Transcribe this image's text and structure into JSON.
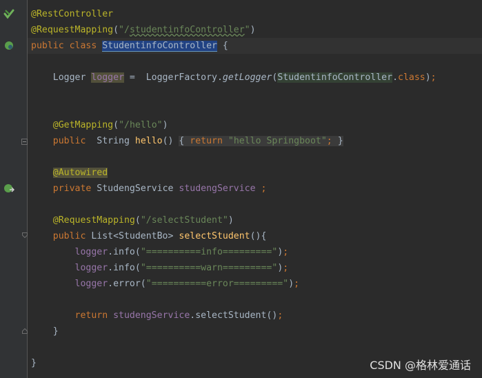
{
  "editor": {
    "lines": [
      [
        {
          "t": "@RestController",
          "c": "ann"
        }
      ],
      [
        {
          "t": "@RequestMapping",
          "c": "ann"
        },
        {
          "t": "("
        },
        {
          "t": "\"/",
          "c": "str"
        },
        {
          "t": "studentinfoController",
          "c": "str squig"
        },
        {
          "t": "\"",
          "c": "str"
        },
        {
          "t": ")"
        }
      ],
      [
        {
          "t": "public class ",
          "c": "kw"
        },
        {
          "t": "StudentinfoController",
          "c": "sel"
        },
        {
          "t": " {"
        }
      ],
      [],
      [
        {
          "t": "    Logger "
        },
        {
          "t": "logger",
          "c": "fld hl-var"
        },
        {
          "t": " =  LoggerFactory."
        },
        {
          "t": "getLogger",
          "c": "italic"
        },
        {
          "t": "("
        },
        {
          "t": "StudentinfoController",
          "c": "hl-ref"
        },
        {
          "t": "."
        },
        {
          "t": "class",
          "c": "kw"
        },
        {
          "t": ")"
        },
        {
          "t": ";",
          "c": "kw"
        }
      ],
      [],
      [],
      [
        {
          "t": "    "
        },
        {
          "t": "@GetMapping",
          "c": "ann"
        },
        {
          "t": "("
        },
        {
          "t": "\"/hello\"",
          "c": "str"
        },
        {
          "t": ")"
        }
      ],
      [
        {
          "t": "    "
        },
        {
          "t": "public  ",
          "c": "kw"
        },
        {
          "t": "String "
        },
        {
          "t": "hello",
          "c": "meth"
        },
        {
          "t": "() "
        },
        {
          "t": "{ ",
          "c": "fold-txt"
        },
        {
          "t": "return ",
          "c": "kw fold-txt"
        },
        {
          "t": "\"hello Springboot\"",
          "c": "str fold-txt"
        },
        {
          "t": ";",
          "c": "kw fold-txt"
        },
        {
          "t": " }",
          "c": "fold-txt"
        }
      ],
      [],
      [
        {
          "t": "    "
        },
        {
          "t": "@Autowired",
          "c": "ann hl-var"
        }
      ],
      [
        {
          "t": "    "
        },
        {
          "t": "private ",
          "c": "kw"
        },
        {
          "t": "StudengService "
        },
        {
          "t": "studengService",
          "c": "fld"
        },
        {
          "t": " ;",
          "c": "kw"
        }
      ],
      [],
      [
        {
          "t": "    "
        },
        {
          "t": "@RequestMapping",
          "c": "ann"
        },
        {
          "t": "("
        },
        {
          "t": "\"/selectStudent\"",
          "c": "str"
        },
        {
          "t": ")"
        }
      ],
      [
        {
          "t": "    "
        },
        {
          "t": "public ",
          "c": "kw"
        },
        {
          "t": "List<StudentBo> "
        },
        {
          "t": "selectStudent",
          "c": "meth"
        },
        {
          "t": "(){"
        }
      ],
      [
        {
          "t": "        "
        },
        {
          "t": "logger",
          "c": "fld"
        },
        {
          "t": ".info("
        },
        {
          "t": "\"==========info=========\"",
          "c": "str"
        },
        {
          "t": ")"
        },
        {
          "t": ";",
          "c": "kw"
        }
      ],
      [
        {
          "t": "        "
        },
        {
          "t": "logger",
          "c": "fld"
        },
        {
          "t": ".info("
        },
        {
          "t": "\"==========warn=========\"",
          "c": "str"
        },
        {
          "t": ")"
        },
        {
          "t": ";",
          "c": "kw"
        }
      ],
      [
        {
          "t": "        "
        },
        {
          "t": "logger",
          "c": "fld"
        },
        {
          "t": ".error("
        },
        {
          "t": "\"==========error=========\"",
          "c": "str"
        },
        {
          "t": ")"
        },
        {
          "t": ";",
          "c": "kw"
        }
      ],
      [],
      [
        {
          "t": "        "
        },
        {
          "t": "return ",
          "c": "kw"
        },
        {
          "t": "studengService",
          "c": "fld"
        },
        {
          "t": ".selectStudent()"
        },
        {
          "t": ";",
          "c": "kw"
        }
      ],
      [
        {
          "t": "    }"
        }
      ],
      [],
      [
        {
          "t": "}"
        }
      ]
    ]
  },
  "gutter_icons": [
    "spring-bean-icon",
    "spring-bean-icon",
    "autowired-bean-icon"
  ],
  "watermark": "CSDN @格林爱通话",
  "colors": {
    "background": "#2b2b2b",
    "gutter": "#313335",
    "keyword": "#cc7832",
    "annotation": "#bbb529",
    "string": "#6a8759",
    "field": "#9876aa",
    "method": "#ffc66d",
    "text": "#a9b7c6"
  }
}
